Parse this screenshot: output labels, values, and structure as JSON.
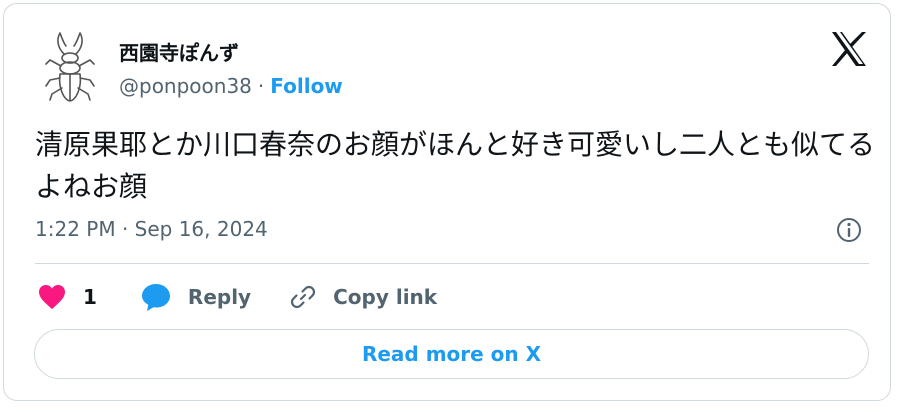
{
  "author": {
    "display_name": "西園寺ぽんず",
    "handle": "@ponpoon38",
    "separator": "·",
    "follow_label": "Follow"
  },
  "tweet": {
    "text": "清原果耶とか川口春奈のお顔がほんと好き可愛いし二人とも似てるよねお顔",
    "timestamp": "1:22 PM · Sep 16, 2024"
  },
  "actions": {
    "like_count": "1",
    "reply_label": "Reply",
    "copy_link_label": "Copy link"
  },
  "footer": {
    "read_more_label": "Read more on X"
  },
  "icons": {
    "brand": "x-logo-icon",
    "info": "info-icon",
    "like": "heart-icon",
    "reply": "speech-bubble-icon",
    "copy": "link-icon"
  },
  "colors": {
    "accent": "#1d9bf0",
    "heart": "#f91880",
    "text": "#0f1419",
    "muted": "#536471",
    "border": "#cfd9de"
  }
}
